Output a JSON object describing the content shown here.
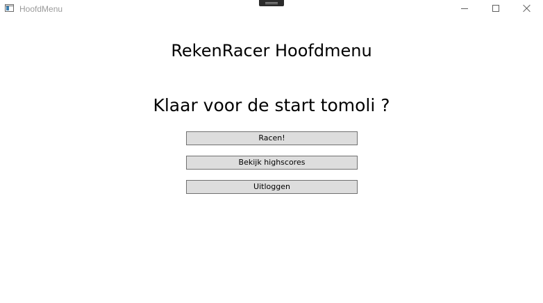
{
  "window": {
    "title": "HoofdMenu"
  },
  "main": {
    "title": "RekenRacer Hoofdmenu",
    "greeting": "Klaar voor de start tomoli ?",
    "buttons": [
      {
        "label": "Racen!"
      },
      {
        "label": "Bekijk highscores"
      },
      {
        "label": "Uitloggen"
      }
    ]
  },
  "colors": {
    "background": "#ffffff",
    "button_face": "#dddddd",
    "button_border": "#707070",
    "titlebar_text": "#9a9a9a"
  },
  "icons": {
    "app": "app-window-icon",
    "minimize": "minimize-icon",
    "maximize": "maximize-icon",
    "close": "close-icon"
  }
}
